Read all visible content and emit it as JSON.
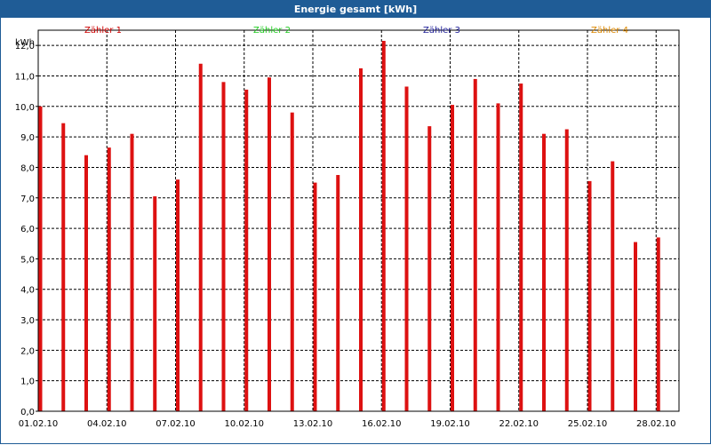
{
  "window": {
    "title": "Energie gesamt [kWh]"
  },
  "legend": [
    {
      "label": "Zähler 1",
      "color": "#cc0000"
    },
    {
      "label": "Zähler 2",
      "color": "#22cc22"
    },
    {
      "label": "Zähler 3",
      "color": "#222299"
    },
    {
      "label": "Zähler 4",
      "color": "#dd8800"
    }
  ],
  "chart_data": {
    "type": "bar",
    "title": "Energie gesamt [kWh]",
    "unit_label": "kWh",
    "ylim": [
      0,
      12.5
    ],
    "y_ticks": [
      "0,0",
      "1,0",
      "2,0",
      "3,0",
      "4,0",
      "5,0",
      "6,0",
      "7,0",
      "8,0",
      "9,0",
      "10,0",
      "11,0",
      "12,0"
    ],
    "x_tick_labels": [
      "01.02.10",
      "04.02.10",
      "07.02.10",
      "10.02.10",
      "13.02.10",
      "16.02.10",
      "19.02.10",
      "22.02.10",
      "25.02.10",
      "28.02.10"
    ],
    "categories": [
      "01.02.10",
      "02.02.10",
      "03.02.10",
      "04.02.10",
      "05.02.10",
      "06.02.10",
      "07.02.10",
      "08.02.10",
      "09.02.10",
      "10.02.10",
      "11.02.10",
      "12.02.10",
      "13.02.10",
      "14.02.10",
      "15.02.10",
      "16.02.10",
      "17.02.10",
      "18.02.10",
      "19.02.10",
      "20.02.10",
      "21.02.10",
      "22.02.10",
      "23.02.10",
      "24.02.10",
      "25.02.10",
      "26.02.10",
      "27.02.10",
      "28.02.10"
    ],
    "grid": true,
    "series": [
      {
        "name": "Zähler 1",
        "color": "#dd1111",
        "values": [
          10.0,
          9.45,
          8.4,
          8.65,
          9.1,
          7.05,
          7.6,
          11.4,
          10.8,
          10.55,
          10.95,
          9.8,
          7.5,
          7.75,
          11.25,
          12.15,
          10.65,
          9.35,
          10.05,
          10.9,
          10.1,
          10.75,
          9.1,
          9.25,
          7.55,
          8.2,
          5.55,
          5.7
        ]
      }
    ]
  }
}
